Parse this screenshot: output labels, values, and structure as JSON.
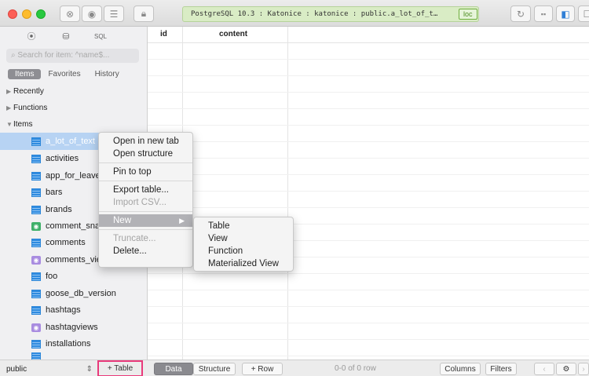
{
  "titlebar": {
    "connection": "PostgreSQL 10.3 : Katonice : katonice : public.a_lot_of_t…",
    "badge": "loc"
  },
  "sidebar": {
    "search_placeholder": "Search for item: ^name$...",
    "segments": [
      "Items",
      "Favorites",
      "History"
    ],
    "groups": [
      {
        "label": "Recently",
        "expanded": false
      },
      {
        "label": "Functions",
        "expanded": false
      },
      {
        "label": "Items",
        "expanded": true
      }
    ],
    "items": [
      {
        "label": "a_lot_of_text",
        "icon": "table-icon",
        "selected": true
      },
      {
        "label": "activities",
        "icon": "table-icon"
      },
      {
        "label": "app_for_leave",
        "icon": "table-icon"
      },
      {
        "label": "bars",
        "icon": "table-icon"
      },
      {
        "label": "brands",
        "icon": "table-icon"
      },
      {
        "label": "comment_snap",
        "icon": "materialized-view-icon"
      },
      {
        "label": "comments",
        "icon": "table-icon"
      },
      {
        "label": "comments_view",
        "icon": "view-icon"
      },
      {
        "label": "foo",
        "icon": "table-icon"
      },
      {
        "label": "goose_db_version",
        "icon": "table-icon"
      },
      {
        "label": "hashtags",
        "icon": "table-icon"
      },
      {
        "label": "hashtagviews",
        "icon": "view-icon"
      },
      {
        "label": "installations",
        "icon": "table-icon"
      }
    ]
  },
  "grid": {
    "columns": [
      "id",
      "content"
    ]
  },
  "context_menu": {
    "open_new_tab": "Open in new tab",
    "open_structure": "Open structure",
    "pin_to_top": "Pin to top",
    "export_table": "Export table...",
    "import_csv": "Import CSV...",
    "new": "New",
    "truncate": "Truncate...",
    "delete": "Delete..."
  },
  "submenu": {
    "items": [
      "Table",
      "View",
      "Function",
      "Materialized View"
    ]
  },
  "bottombar": {
    "schema": "public",
    "add_table": "+ Table",
    "tab_data": "Data",
    "tab_structure": "Structure",
    "add_row": "+ Row",
    "row_count": "0-0 of 0 row",
    "columns_button": "Columns",
    "filters_button": "Filters"
  },
  "colors": {
    "selection": "#b7d3f3",
    "connection_bg": "#d9ecc5",
    "highlight_border": "#e93a7b"
  }
}
